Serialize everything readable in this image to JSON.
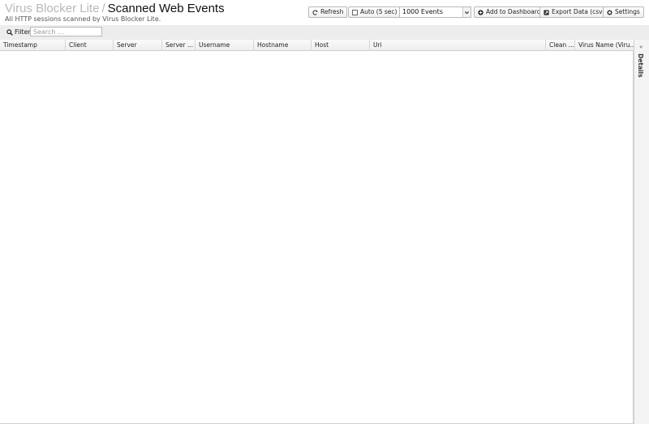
{
  "header": {
    "app_name": "Virus Blocker Lite",
    "separator": "/",
    "page_title": "Scanned Web Events",
    "subtitle": "All HTTP sessions scanned by Virus Blocker Lite."
  },
  "toolbar": {
    "refresh_label": "Refresh",
    "auto_label": "Auto (5 sec)",
    "events_select": "1000 Events",
    "add_dashboard_label": "Add to Dashboard",
    "export_label": "Export Data (csv)",
    "settings_label": "Settings"
  },
  "filter": {
    "label": "Filter",
    "placeholder": "Search ..."
  },
  "grid": {
    "columns": [
      "Timestamp",
      "Client",
      "Server",
      "Server ...",
      "Username",
      "Hostname",
      "Host",
      "Uri",
      "Clean ...",
      "Virus Name (Viru..."
    ]
  },
  "details": {
    "label": "Details"
  }
}
